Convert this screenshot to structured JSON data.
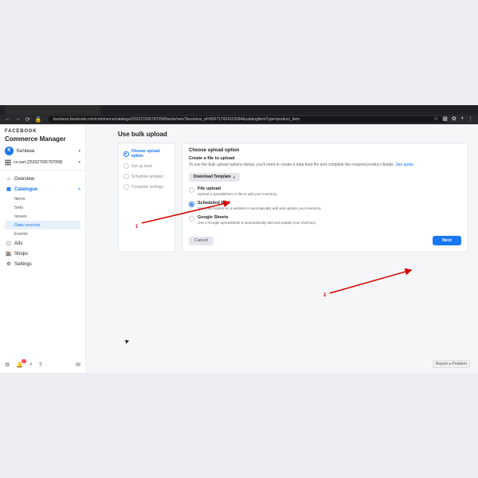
{
  "browser": {
    "url": "business.facebook.com/commerce/catalogs/253327026797058/feeds/new?business_id=826717424119184&catalogItemType=product_item"
  },
  "brand": {
    "logo": "FACEBOOK",
    "product": "Commerce Manager"
  },
  "account": {
    "initial": "K",
    "name": "Катюша"
  },
  "store": {
    "name": "cs-cart (253327026797058)"
  },
  "sidebar": {
    "overview": "Overview",
    "catalogue": "Catalogue",
    "subs": {
      "items": "Items",
      "sets": "Sets",
      "issues": "Issues",
      "datasources": "Data sources",
      "events": "Events"
    },
    "ads": "Ads",
    "shops": "Shops",
    "settings": "Settings",
    "badge": "2"
  },
  "main": {
    "title": "Use bulk upload",
    "steps": {
      "s1": "Choose upload option",
      "s2": "Set up feed",
      "s3": "Schedule updates",
      "s4": "Complete settings"
    },
    "card": {
      "heading": "Choose upload option",
      "sub": "Create a file to upload",
      "desc": "To use the bulk upload options below, you'll need to create a data feed file and complete the required product details.",
      "guide": "See guide",
      "download": "Download Template",
      "opt1": {
        "t": "File upload",
        "d": "Upload a spreadsheet or file to add your inventory."
      },
      "opt2": {
        "t": "Scheduled feed",
        "d": "Use a file hosted on a website to automatically add and update your inventory."
      },
      "opt3": {
        "t": "Google Sheets",
        "d": "Use a Google spreadsheet to automatically add and update your inventory."
      },
      "cancel": "Cancel",
      "next": "Next"
    },
    "report": "Report a Problem"
  },
  "annot": {
    "one": "1",
    "two": "2"
  }
}
